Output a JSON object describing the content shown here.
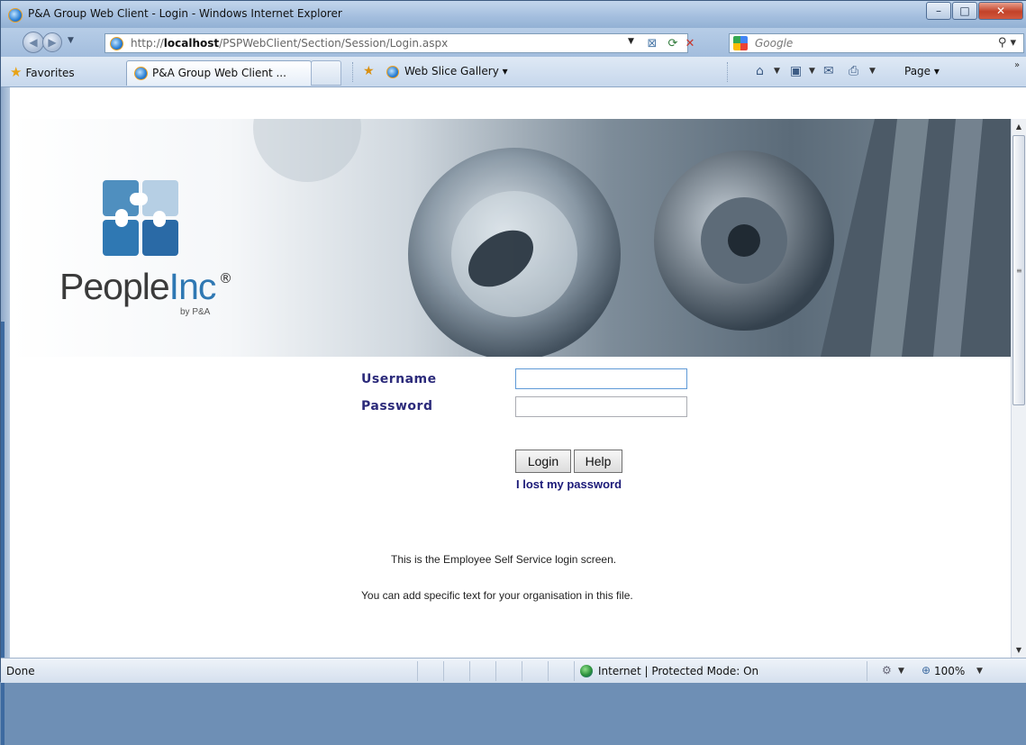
{
  "window": {
    "title": "P&A Group Web Client - Login - Windows Internet Explorer",
    "controls": {
      "minimize": "–",
      "maximize": "□",
      "close": "✕"
    }
  },
  "address": {
    "url_prefix": "http://",
    "url_host": "localhost",
    "url_path": "/PSPWebClient/Section/Session/Login.aspx",
    "search_placeholder": "Google"
  },
  "favorites_bar": {
    "favorites_label": "Favorites",
    "tab_label": "P&A Group Web Client ...",
    "web_slice_label": "Web Slice Gallery ▾",
    "page_label": "Page ▾"
  },
  "page": {
    "brand_people": "People",
    "brand_inc": "Inc",
    "brand_reg": "®",
    "brand_by": "by P&A",
    "username_label": "Username",
    "password_label": "Password",
    "username_value": "",
    "password_value": "",
    "login_button": "Login",
    "help_button": "Help",
    "lost_password_link": "I lost my password",
    "info_line_1": "This is the Employee Self Service login screen.",
    "info_line_2": "You can add specific text for your organisation in this file."
  },
  "status_bar": {
    "status": "Done",
    "zone": "Internet | Protected Mode: On",
    "zoom": "100%"
  },
  "colors": {
    "label_navy": "#2b2a7a",
    "brand_blue": "#2f78b3"
  }
}
